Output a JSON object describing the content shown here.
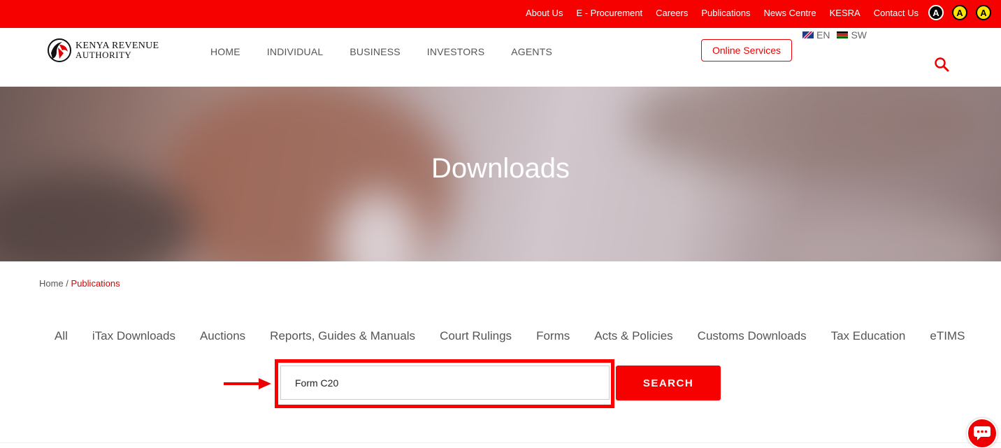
{
  "topbar": {
    "links": [
      "About Us",
      "E - Procurement",
      "Careers",
      "Publications",
      "News Centre",
      "KESRA",
      "Contact Us"
    ],
    "accessibility": [
      "A",
      "A",
      "A"
    ]
  },
  "header": {
    "logo_line1": "Kenya Revenue",
    "logo_line2": "Authority",
    "nav": [
      "HOME",
      "INDIVIDUAL",
      "BUSINESS",
      "INVESTORS",
      "AGENTS"
    ],
    "online_services": "Online Services",
    "languages": [
      "EN",
      "SW"
    ]
  },
  "hero": {
    "title": "Downloads"
  },
  "breadcrumb": {
    "home": "Home",
    "separator": " / ",
    "current": "Publications"
  },
  "categories": [
    "All",
    "iTax Downloads",
    "Auctions",
    "Reports, Guides & Manuals",
    "Court Rulings",
    "Forms",
    "Acts & Policies",
    "Customs Downloads",
    "Tax Education",
    "eTIMS"
  ],
  "search": {
    "value": "Form C20",
    "button_label": "SEARCH"
  },
  "colors": {
    "brand_red": "#f70000",
    "highlight_red": "#ff0000"
  },
  "icons": {
    "search": "search-icon",
    "chat": "chat-icon",
    "arrow": "arrow-right-icon"
  }
}
